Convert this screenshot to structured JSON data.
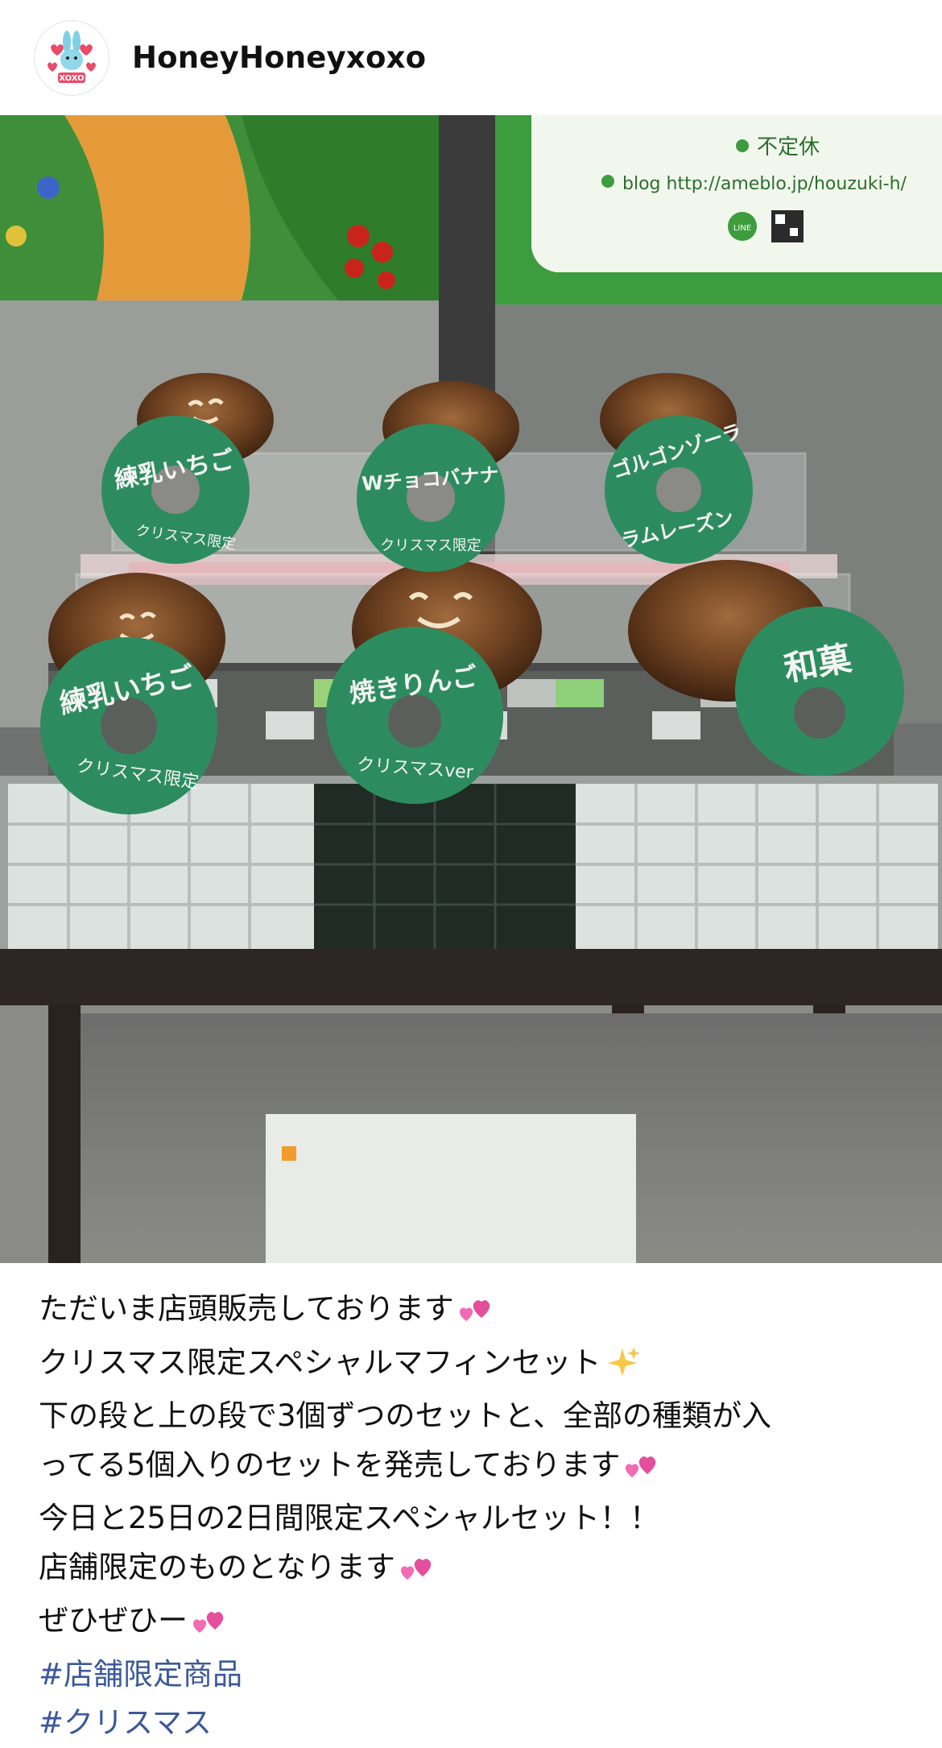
{
  "post": {
    "username": "HoneyHoneyxoxo",
    "avatar_icon": "bunny-logo-icon",
    "avatar_text": "XOXO"
  },
  "photo": {
    "sign_lines": [
      "不定休",
      "blog http://ameblo.jp/houzuki-h/"
    ],
    "line_label": "LINE",
    "tags_top": [
      {
        "line1": "練乳いちご",
        "line2": "クリスマス限定"
      },
      {
        "line1": "Wチョコバナナ",
        "line2": "クリスマス限定"
      },
      {
        "line1": "ゴルゴンゾーラ",
        "line2": "ラムレーズン"
      }
    ],
    "tags_bottom": [
      {
        "line1": "練乳いちご",
        "line2": "クリスマス限定"
      },
      {
        "line1": "焼きりんご",
        "line2": "クリスマスver"
      },
      {
        "line1": "和菓",
        "line2": ""
      }
    ]
  },
  "caption": {
    "lines": [
      "ただいま店頭販売しております",
      "クリスマス限定スペシャルマフィンセット",
      "下の段と上の段で3個ずつのセットと、全部の種類が入",
      "ってる5個入りのセットを発売しております",
      "今日と25日の2日間限定スペシャルセット！！",
      "店舗限定のものとなります",
      "ぜひぜひー"
    ],
    "hashtags": [
      "#店舗限定商品",
      "#クリスマス"
    ],
    "emoji": {
      "hearts": "two-hearts-icon",
      "sparkles": "sparkles-icon"
    }
  }
}
